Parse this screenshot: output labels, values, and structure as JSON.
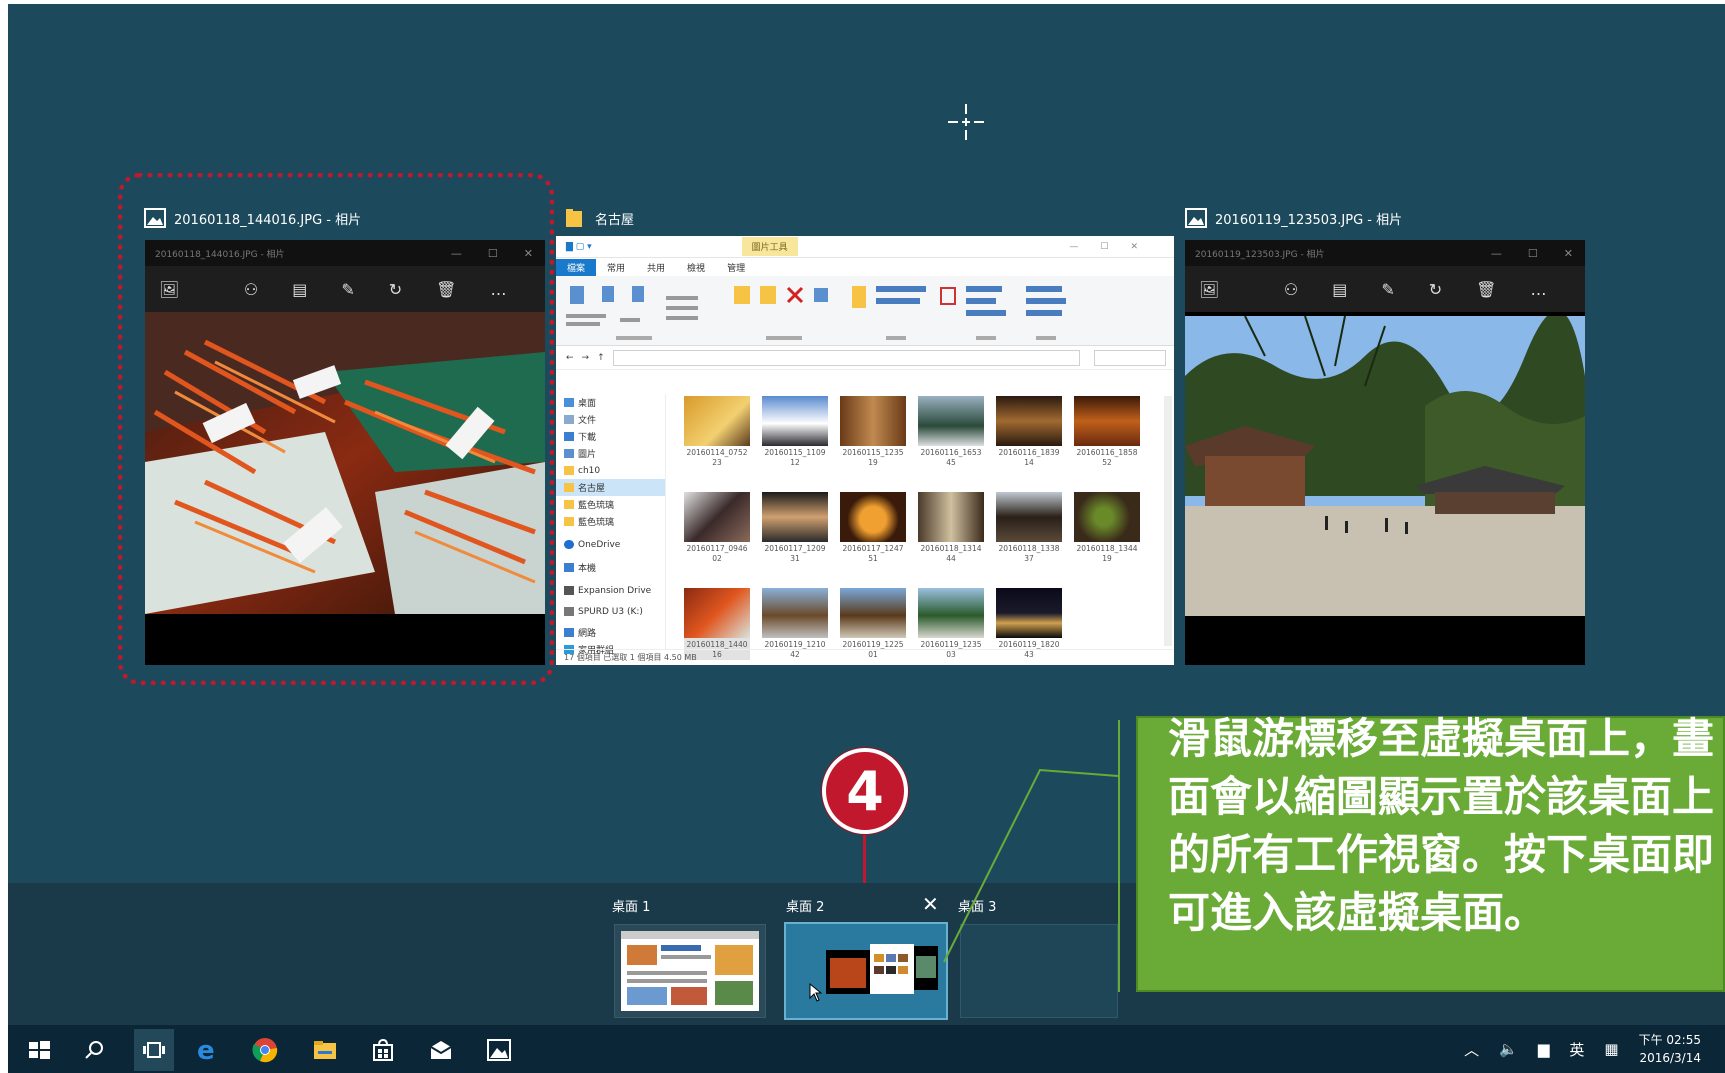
{
  "windows": [
    {
      "title": "20160118_144016.JPG - 相片",
      "inner_title": "20160118_144016.JPG - 相片"
    },
    {
      "title": "名古屋"
    },
    {
      "title": "20160119_123503.JPG - 相片",
      "inner_title": "20160119_123503.JPG - 相片"
    }
  ],
  "explorer": {
    "tools_tab": "圖片工具",
    "tabs": [
      "檔案",
      "常用",
      "共用",
      "檢視",
      "管理"
    ],
    "nav": [
      "桌面",
      "文件",
      "下載",
      "圖片",
      "ch10",
      "名古屋",
      "藍色琉璃",
      "藍色琉璃",
      "OneDrive",
      "本機",
      "Expansion Drive",
      "SPURD U3 (K:)",
      "網路",
      "家用群組"
    ],
    "files": [
      [
        "20160114_0752",
        "23"
      ],
      [
        "20160115_1109",
        "12"
      ],
      [
        "20160115_1235",
        "19"
      ],
      [
        "20160116_1653",
        "45"
      ],
      [
        "20160116_1839",
        "14"
      ],
      [
        "20160116_1858",
        "52"
      ],
      [
        "20160117_0946",
        "02"
      ],
      [
        "20160117_1209",
        "31"
      ],
      [
        "20160117_1247",
        "51"
      ],
      [
        "20160118_1314",
        "44"
      ],
      [
        "20160118_1338",
        "37"
      ],
      [
        "20160118_1344",
        "19"
      ],
      [
        "20160118_1440",
        "16"
      ],
      [
        "20160119_1210",
        "42"
      ],
      [
        "20160119_1225",
        "01"
      ],
      [
        "20160119_1235",
        "03"
      ],
      [
        "20160119_1820",
        "43"
      ]
    ],
    "status": "17 個項目    已選取 1 個項目 4.50 MB"
  },
  "desktops": [
    {
      "label": "桌面 1"
    },
    {
      "label": "桌面 2"
    },
    {
      "label": "桌面 3"
    }
  ],
  "step_number": "4",
  "callout_text": "滑鼠游標移至虛擬桌面上，畫面會以縮圖顯示置於該桌面上的所有工作視窗。按下桌面即可進入該虛擬桌面。",
  "tray": {
    "ime": "英",
    "time": "下午 02:55",
    "date": "2016/3/14"
  },
  "colors": {
    "desktop_bg": "#1c4a5c",
    "highlight_red": "#c1182d",
    "callout_green": "#6aab38",
    "taskbar": "#0b2636"
  }
}
